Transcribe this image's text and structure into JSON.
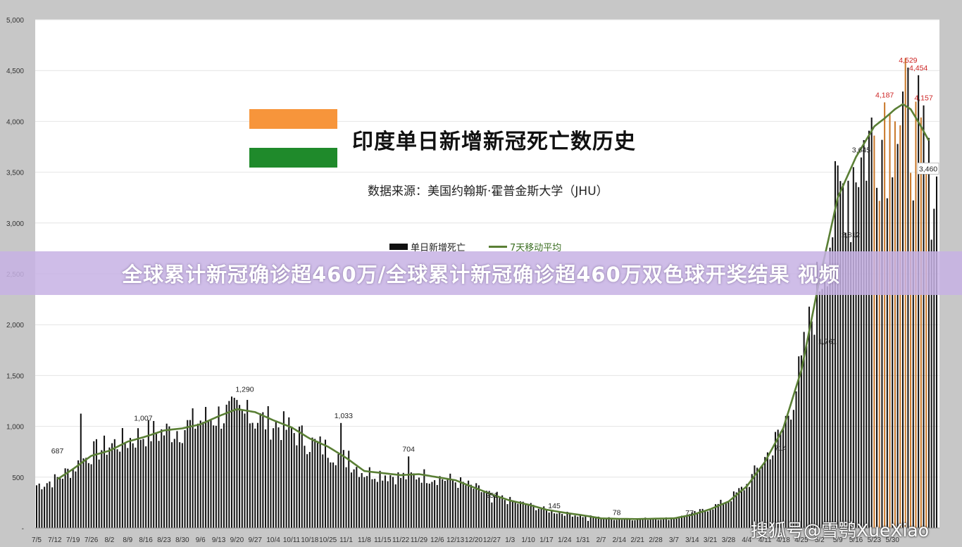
{
  "title": "印度单日新增新冠死亡数历史",
  "subtitle": "数据来源：美国约翰斯·霍普金斯大学（JHU）",
  "legend": {
    "bar": "单日新增死亡",
    "line": "7天移动平均"
  },
  "banner": "全球累计新冠确诊超460万/全球累计新冠确诊超460万双色球开奖结果 视频",
  "watermark": "搜狐号@雪鹗XueXiao",
  "colors": {
    "bar": "#111111",
    "bar_highlight": "#c9782a",
    "line": "#5a7f35",
    "label_highlight": "#cc2222"
  },
  "chart_data": {
    "type": "bar",
    "ylim": [
      0,
      5000
    ],
    "yticks": [
      "-",
      "500",
      "1,000",
      "1,500",
      "2,000",
      "2,500",
      "3,000",
      "3,500",
      "4,000",
      "4,500",
      "5,000"
    ],
    "x_tick_labels": [
      "7/5",
      "7/12",
      "7/19",
      "7/26",
      "8/2",
      "8/9",
      "8/16",
      "8/23",
      "8/30",
      "9/6",
      "9/13",
      "9/20",
      "9/27",
      "10/4",
      "10/11",
      "10/18",
      "10/25",
      "11/1",
      "11/8",
      "11/15",
      "11/22",
      "11/29",
      "12/6",
      "12/13",
      "12/20",
      "12/27",
      "1/3",
      "1/10",
      "1/17",
      "1/24",
      "1/31",
      "2/7",
      "2/14",
      "2/21",
      "2/28",
      "3/7",
      "3/14",
      "3/21",
      "3/28",
      "4/4",
      "4/11",
      "4/18",
      "4/25",
      "5/2",
      "5/9",
      "5/16",
      "5/23",
      "5/30"
    ],
    "anchors": [
      [
        0,
        430
      ],
      [
        7,
        480
      ],
      [
        14,
        600
      ],
      [
        21,
        750
      ],
      [
        28,
        830
      ],
      [
        35,
        880
      ],
      [
        42,
        950
      ],
      [
        49,
        960
      ],
      [
        56,
        1000
      ],
      [
        63,
        1080
      ],
      [
        70,
        1130
      ],
      [
        77,
        1150
      ],
      [
        84,
        1100
      ],
      [
        91,
        1050
      ],
      [
        98,
        980
      ],
      [
        105,
        860
      ],
      [
        112,
        790
      ],
      [
        119,
        690
      ],
      [
        126,
        560
      ],
      [
        133,
        550
      ],
      [
        140,
        510
      ],
      [
        147,
        530
      ],
      [
        154,
        510
      ],
      [
        161,
        470
      ],
      [
        168,
        400
      ],
      [
        175,
        330
      ],
      [
        182,
        270
      ],
      [
        189,
        230
      ],
      [
        196,
        180
      ],
      [
        203,
        145
      ],
      [
        210,
        120
      ],
      [
        217,
        100
      ],
      [
        224,
        90
      ],
      [
        231,
        90
      ],
      [
        238,
        95
      ],
      [
        245,
        95
      ],
      [
        252,
        140
      ],
      [
        259,
        200
      ],
      [
        266,
        280
      ],
      [
        273,
        430
      ],
      [
        280,
        700
      ],
      [
        287,
        1000
      ],
      [
        294,
        1600
      ],
      [
        301,
        2500
      ],
      [
        308,
        3300
      ],
      [
        315,
        3700
      ],
      [
        322,
        3950
      ],
      [
        326,
        3900
      ],
      [
        330,
        4100
      ],
      [
        333,
        4150
      ],
      [
        336,
        4000
      ],
      [
        340,
        3700
      ],
      [
        343,
        3450
      ],
      [
        346,
        3400
      ]
    ],
    "line_anchors": [
      [
        8,
        480
      ],
      [
        14,
        580
      ],
      [
        21,
        710
      ],
      [
        28,
        760
      ],
      [
        35,
        850
      ],
      [
        42,
        900
      ],
      [
        49,
        960
      ],
      [
        56,
        980
      ],
      [
        63,
        1020
      ],
      [
        70,
        1100
      ],
      [
        77,
        1170
      ],
      [
        84,
        1140
      ],
      [
        91,
        1060
      ],
      [
        98,
        990
      ],
      [
        105,
        880
      ],
      [
        112,
        800
      ],
      [
        119,
        690
      ],
      [
        126,
        560
      ],
      [
        133,
        540
      ],
      [
        140,
        520
      ],
      [
        147,
        530
      ],
      [
        154,
        500
      ],
      [
        161,
        470
      ],
      [
        168,
        400
      ],
      [
        175,
        330
      ],
      [
        182,
        270
      ],
      [
        189,
        230
      ],
      [
        196,
        180
      ],
      [
        203,
        150
      ],
      [
        210,
        125
      ],
      [
        217,
        95
      ],
      [
        224,
        90
      ],
      [
        231,
        88
      ],
      [
        238,
        92
      ],
      [
        245,
        95
      ],
      [
        252,
        130
      ],
      [
        259,
        185
      ],
      [
        266,
        260
      ],
      [
        273,
        410
      ],
      [
        280,
        650
      ],
      [
        287,
        980
      ],
      [
        294,
        1550
      ],
      [
        301,
        2450
      ],
      [
        308,
        3250
      ],
      [
        315,
        3650
      ],
      [
        322,
        3950
      ],
      [
        326,
        4030
      ],
      [
        330,
        4120
      ],
      [
        333,
        4170
      ],
      [
        336,
        4120
      ],
      [
        340,
        3950
      ],
      [
        343,
        3810
      ]
    ],
    "annotations": [
      {
        "day": 8,
        "value": 687,
        "label": "687"
      },
      {
        "day": 41,
        "value": 1007,
        "label": "1,007"
      },
      {
        "day": 80,
        "value": 1290,
        "label": "1,290"
      },
      {
        "day": 118,
        "value": 1033,
        "label": "1,033"
      },
      {
        "day": 143,
        "value": 704,
        "label": "704"
      },
      {
        "day": 175,
        "value": 251,
        "label": "251"
      },
      {
        "day": 199,
        "value": 145,
        "label": "145"
      },
      {
        "day": 223,
        "value": 78,
        "label": "78"
      },
      {
        "day": 251,
        "value": 77,
        "label": "77"
      },
      {
        "day": 286,
        "value": 714,
        "label": "714"
      },
      {
        "day": 304,
        "value": 1761,
        "label": "1,761"
      },
      {
        "day": 313,
        "value": 2812,
        "label": "2,812"
      },
      {
        "day": 317,
        "value": 3645,
        "label": "3,645"
      },
      {
        "day": 326,
        "value": 4187,
        "label": "4,187",
        "highlight": true
      },
      {
        "day": 335,
        "value": 4529,
        "label": "4,529",
        "highlight": true
      },
      {
        "day": 339,
        "value": 4454,
        "label": "4,454",
        "highlight": true
      },
      {
        "day": 341,
        "value": 4157,
        "label": "4,157",
        "highlight": true
      },
      {
        "day": 346,
        "value": 3460,
        "label": "3,460"
      }
    ],
    "spikes": [
      [
        17,
        1125
      ],
      [
        81,
        1260
      ],
      [
        117,
        1033
      ],
      [
        120,
        760
      ],
      [
        143,
        704
      ],
      [
        175,
        251
      ],
      [
        212,
        70
      ],
      [
        283,
        714
      ],
      [
        313,
        2812
      ],
      [
        317,
        3645
      ],
      [
        326,
        4187
      ],
      [
        330,
        4000
      ],
      [
        335,
        4529
      ],
      [
        339,
        4454
      ],
      [
        341,
        4157
      ]
    ],
    "highlight_range": [
      322,
      342
    ]
  }
}
